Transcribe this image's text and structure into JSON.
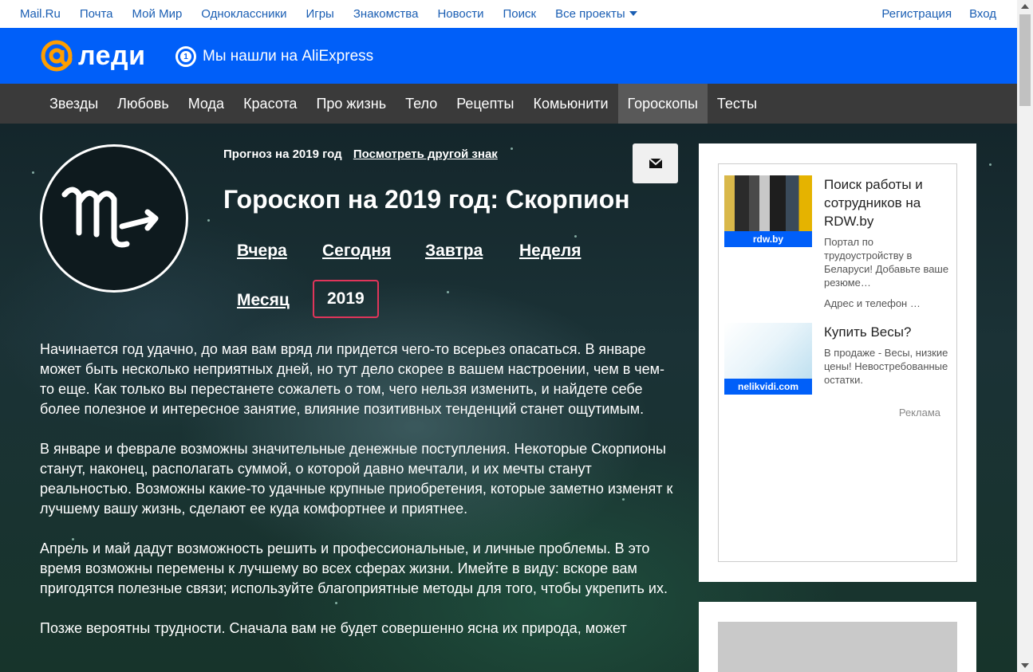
{
  "topbar": {
    "links": [
      "Mail.Ru",
      "Почта",
      "Мой Мир",
      "Одноклассники",
      "Игры",
      "Знакомства",
      "Новости",
      "Поиск",
      "Все проекты"
    ],
    "register": "Регистрация",
    "login": "Вход"
  },
  "header": {
    "logo_text": "леди",
    "promo_text": "Мы нашли на AliExpress",
    "brand_color": "#005ff9",
    "logo_color": "#ff9e00"
  },
  "nav": {
    "items": [
      "Звезды",
      "Любовь",
      "Мода",
      "Красота",
      "Про жизнь",
      "Тело",
      "Рецепты",
      "Комьюнити",
      "Гороскопы",
      "Тесты"
    ],
    "active": "Гороскопы"
  },
  "horoscope": {
    "forecast_label": "Прогноз на 2019 год",
    "other_sign_link": "Посмотреть другой знак",
    "title": "Гороскоп на 2019 год: Скорпион",
    "periods": {
      "yesterday": "Вчера",
      "today": "Сегодня",
      "tomorrow": "Завтра",
      "week": "Неделя",
      "month": "Месяц",
      "year": "2019"
    },
    "selected_color": "#e0355a",
    "paragraphs": [
      "Начинается год удачно, до мая вам вряд ли придется чего-то всерьез опасаться. В январе может быть несколько неприятных дней, но тут дело скорее в вашем настроении, чем в чем-то еще. Как только вы перестанете сожалеть о том, чего нельзя изменить, и найдете себе более полезное и интересное занятие, влияние позитивных тенденций станет ощутимым.",
      "В январе и феврале возможны значительные денежные поступления. Некоторые Скорпионы станут, наконец, располагать суммой, о которой давно мечтали, и их мечты станут реальностью. Возможны какие-то удачные крупные приобретения, которые заметно изменят к лучшему вашу жизнь, сделают ее куда комфортнее и приятнее.",
      "Апрель и май дадут возможность решить и профессиональные, и личные проблемы. В это время возможны перемены к лучшему во всех сферах жизни. Имейте в виду: вскоре вам пригодятся полезные связи; используйте благоприятные методы для того, чтобы укрепить их.",
      "Позже вероятны трудности. Сначала вам не будет совершенно ясна их природа, может"
    ]
  },
  "ads": {
    "items": [
      {
        "caption": "rdw.by",
        "title": "Поиск работы и сотрудников на RDW.by",
        "desc": "Портал по трудоустройству в Беларуси! Добавьте ваше резюме…",
        "extra": "Адрес и телефон  …"
      },
      {
        "caption": "nelikvidi.com",
        "title": "Купить Весы?",
        "desc": "В продаже - Весы, низкие цены! Невостребованные остатки."
      }
    ],
    "label": "Реклама"
  }
}
